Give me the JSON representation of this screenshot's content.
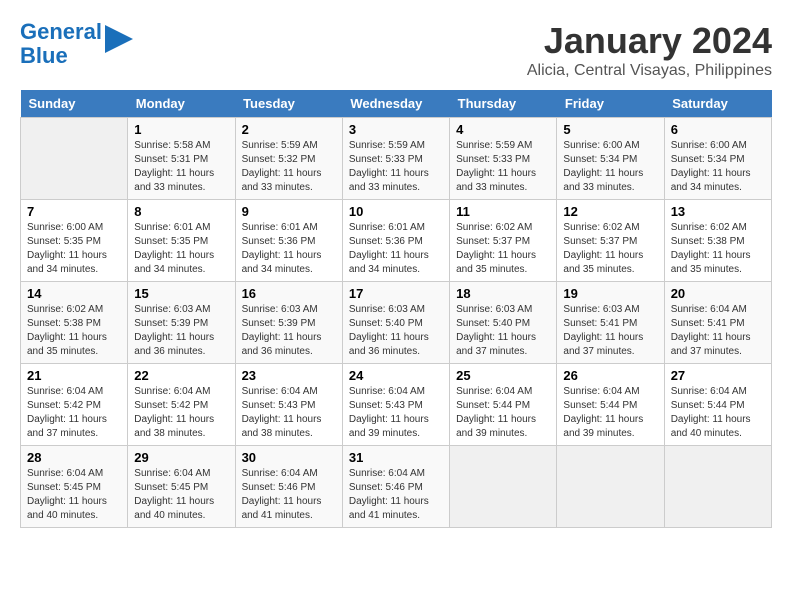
{
  "header": {
    "logo_line1": "General",
    "logo_line2": "Blue",
    "month": "January 2024",
    "location": "Alicia, Central Visayas, Philippines"
  },
  "weekdays": [
    "Sunday",
    "Monday",
    "Tuesday",
    "Wednesday",
    "Thursday",
    "Friday",
    "Saturday"
  ],
  "weeks": [
    [
      {
        "day": "",
        "info": ""
      },
      {
        "day": "1",
        "info": "Sunrise: 5:58 AM\nSunset: 5:31 PM\nDaylight: 11 hours\nand 33 minutes."
      },
      {
        "day": "2",
        "info": "Sunrise: 5:59 AM\nSunset: 5:32 PM\nDaylight: 11 hours\nand 33 minutes."
      },
      {
        "day": "3",
        "info": "Sunrise: 5:59 AM\nSunset: 5:33 PM\nDaylight: 11 hours\nand 33 minutes."
      },
      {
        "day": "4",
        "info": "Sunrise: 5:59 AM\nSunset: 5:33 PM\nDaylight: 11 hours\nand 33 minutes."
      },
      {
        "day": "5",
        "info": "Sunrise: 6:00 AM\nSunset: 5:34 PM\nDaylight: 11 hours\nand 33 minutes."
      },
      {
        "day": "6",
        "info": "Sunrise: 6:00 AM\nSunset: 5:34 PM\nDaylight: 11 hours\nand 34 minutes."
      }
    ],
    [
      {
        "day": "7",
        "info": "Sunrise: 6:00 AM\nSunset: 5:35 PM\nDaylight: 11 hours\nand 34 minutes."
      },
      {
        "day": "8",
        "info": "Sunrise: 6:01 AM\nSunset: 5:35 PM\nDaylight: 11 hours\nand 34 minutes."
      },
      {
        "day": "9",
        "info": "Sunrise: 6:01 AM\nSunset: 5:36 PM\nDaylight: 11 hours\nand 34 minutes."
      },
      {
        "day": "10",
        "info": "Sunrise: 6:01 AM\nSunset: 5:36 PM\nDaylight: 11 hours\nand 34 minutes."
      },
      {
        "day": "11",
        "info": "Sunrise: 6:02 AM\nSunset: 5:37 PM\nDaylight: 11 hours\nand 35 minutes."
      },
      {
        "day": "12",
        "info": "Sunrise: 6:02 AM\nSunset: 5:37 PM\nDaylight: 11 hours\nand 35 minutes."
      },
      {
        "day": "13",
        "info": "Sunrise: 6:02 AM\nSunset: 5:38 PM\nDaylight: 11 hours\nand 35 minutes."
      }
    ],
    [
      {
        "day": "14",
        "info": "Sunrise: 6:02 AM\nSunset: 5:38 PM\nDaylight: 11 hours\nand 35 minutes."
      },
      {
        "day": "15",
        "info": "Sunrise: 6:03 AM\nSunset: 5:39 PM\nDaylight: 11 hours\nand 36 minutes."
      },
      {
        "day": "16",
        "info": "Sunrise: 6:03 AM\nSunset: 5:39 PM\nDaylight: 11 hours\nand 36 minutes."
      },
      {
        "day": "17",
        "info": "Sunrise: 6:03 AM\nSunset: 5:40 PM\nDaylight: 11 hours\nand 36 minutes."
      },
      {
        "day": "18",
        "info": "Sunrise: 6:03 AM\nSunset: 5:40 PM\nDaylight: 11 hours\nand 37 minutes."
      },
      {
        "day": "19",
        "info": "Sunrise: 6:03 AM\nSunset: 5:41 PM\nDaylight: 11 hours\nand 37 minutes."
      },
      {
        "day": "20",
        "info": "Sunrise: 6:04 AM\nSunset: 5:41 PM\nDaylight: 11 hours\nand 37 minutes."
      }
    ],
    [
      {
        "day": "21",
        "info": "Sunrise: 6:04 AM\nSunset: 5:42 PM\nDaylight: 11 hours\nand 37 minutes."
      },
      {
        "day": "22",
        "info": "Sunrise: 6:04 AM\nSunset: 5:42 PM\nDaylight: 11 hours\nand 38 minutes."
      },
      {
        "day": "23",
        "info": "Sunrise: 6:04 AM\nSunset: 5:43 PM\nDaylight: 11 hours\nand 38 minutes."
      },
      {
        "day": "24",
        "info": "Sunrise: 6:04 AM\nSunset: 5:43 PM\nDaylight: 11 hours\nand 39 minutes."
      },
      {
        "day": "25",
        "info": "Sunrise: 6:04 AM\nSunset: 5:44 PM\nDaylight: 11 hours\nand 39 minutes."
      },
      {
        "day": "26",
        "info": "Sunrise: 6:04 AM\nSunset: 5:44 PM\nDaylight: 11 hours\nand 39 minutes."
      },
      {
        "day": "27",
        "info": "Sunrise: 6:04 AM\nSunset: 5:44 PM\nDaylight: 11 hours\nand 40 minutes."
      }
    ],
    [
      {
        "day": "28",
        "info": "Sunrise: 6:04 AM\nSunset: 5:45 PM\nDaylight: 11 hours\nand 40 minutes."
      },
      {
        "day": "29",
        "info": "Sunrise: 6:04 AM\nSunset: 5:45 PM\nDaylight: 11 hours\nand 40 minutes."
      },
      {
        "day": "30",
        "info": "Sunrise: 6:04 AM\nSunset: 5:46 PM\nDaylight: 11 hours\nand 41 minutes."
      },
      {
        "day": "31",
        "info": "Sunrise: 6:04 AM\nSunset: 5:46 PM\nDaylight: 11 hours\nand 41 minutes."
      },
      {
        "day": "",
        "info": ""
      },
      {
        "day": "",
        "info": ""
      },
      {
        "day": "",
        "info": ""
      }
    ]
  ]
}
